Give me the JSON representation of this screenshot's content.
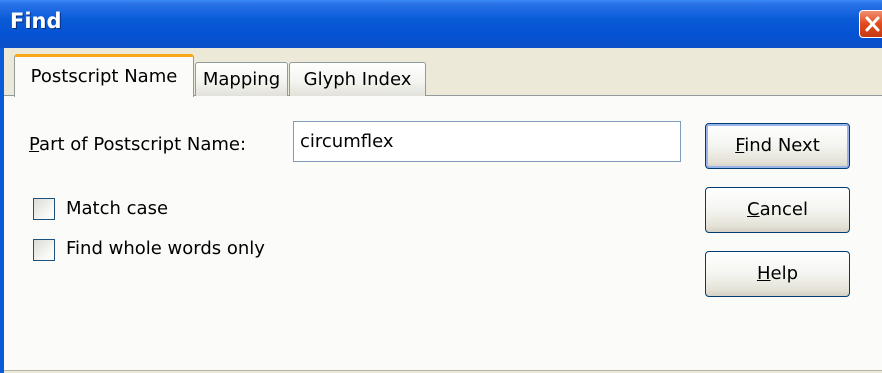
{
  "window": {
    "title": "Find"
  },
  "tabs": [
    {
      "label": "Postscript Name",
      "active": true
    },
    {
      "label": "Mapping",
      "active": false
    },
    {
      "label": "Glyph Index",
      "active": false
    }
  ],
  "search": {
    "label_accel": "P",
    "label_rest": "art of Postscript Name:",
    "value": "circumflex"
  },
  "options": [
    {
      "label": "Match case",
      "checked": false
    },
    {
      "label": "Find whole words only",
      "checked": false
    }
  ],
  "buttons": {
    "find_next_accel": "F",
    "find_next_rest": "ind Next",
    "cancel_accel": "C",
    "cancel_rest": "ancel",
    "help_accel": "H",
    "help_rest": "elp"
  },
  "colors": {
    "titlebar": "#0553d3",
    "dialog_bg": "#ece9d8",
    "panel_bg": "#fbfbf9",
    "active_tab_accent": "#f6a818",
    "close_button": "#e24a1e"
  },
  "icons": {
    "close": "close-icon"
  }
}
